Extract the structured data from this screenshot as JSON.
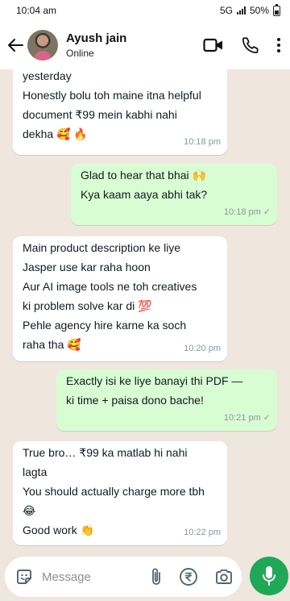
{
  "status_bar": {
    "time": "10:04 am",
    "network": "5G",
    "battery": "50%"
  },
  "header": {
    "name": "Ayush jain",
    "status": "Online"
  },
  "messages": [
    {
      "direction": "in",
      "lines": [
        "yesterday",
        "Honestly bolu toh maine itna helpful",
        "document ₹99 mein kabhi nahi",
        "dekha 🥰 🔥"
      ],
      "time": "10:18 pm"
    },
    {
      "direction": "out",
      "lines": [
        "Glad to hear that bhai 🙌",
        "Kya kaam aaya abhi tak?"
      ],
      "time": "10:18 pm",
      "read": "✓"
    },
    {
      "direction": "in",
      "lines": [
        " Main product description ke liye",
        "Jasper use kar raha hoon",
        "Aur AI image tools ne toh creatives",
        "ki problem solve kar di 💯",
        "Pehle agency hire karne ka soch",
        "raha tha 🥰"
      ],
      "time": "10:20 pm"
    },
    {
      "direction": "out",
      "lines": [
        " Exactly isi ke liye banayi thi PDF —",
        "ki time + paisa dono bache!"
      ],
      "time": "10:21 pm",
      "read": "✓"
    },
    {
      "direction": "in",
      "lines": [
        " True bro… ₹99 ka matlab hi nahi",
        "lagta",
        "You should actually charge more tbh",
        "😂",
        "Good work 👏"
      ],
      "time": "10:22 pm"
    }
  ],
  "input": {
    "placeholder": "Message"
  },
  "colors": {
    "chat_bg": "#efe7de",
    "incoming": "#ffffff",
    "outgoing": "#d9fdd3",
    "accent": "#1fa855"
  },
  "icons": [
    "back-arrow-icon",
    "video-call-icon",
    "phone-icon",
    "more-icon",
    "sticker-icon",
    "attach-icon",
    "rupee-icon",
    "camera-icon",
    "mic-icon"
  ]
}
